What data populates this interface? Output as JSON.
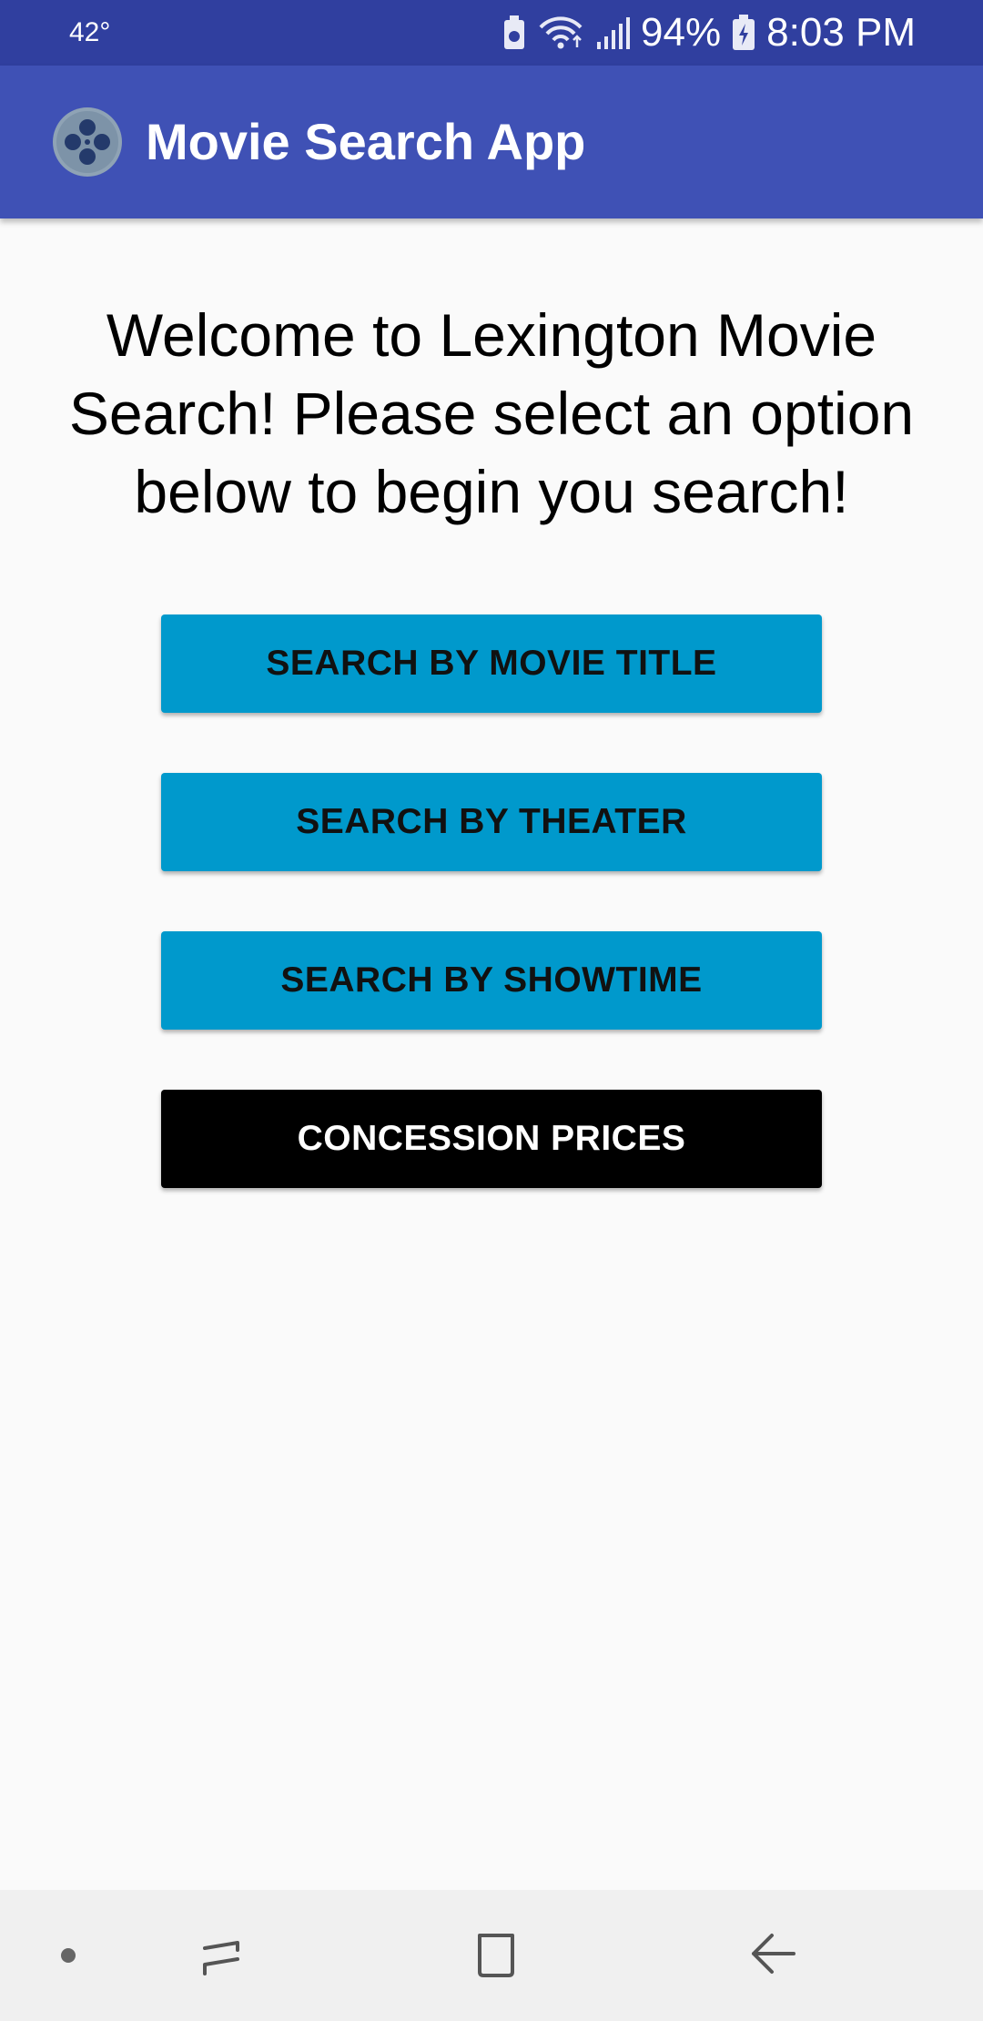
{
  "status_bar": {
    "temperature": "42°",
    "battery_percent": "94%",
    "time": "8:03 PM",
    "icons": [
      "battery-saver-icon",
      "wifi-icon",
      "signal-icon",
      "battery-charging-icon"
    ]
  },
  "app_bar": {
    "title": "Movie Search App",
    "logo_icon": "film-reel-icon"
  },
  "welcome_text": "Welcome to Lexington Movie Search! Please select an option below to begin you search!",
  "buttons": [
    {
      "label": "SEARCH BY MOVIE TITLE",
      "style": "blue"
    },
    {
      "label": "SEARCH BY THEATER",
      "style": "blue"
    },
    {
      "label": "SEARCH BY SHOWTIME",
      "style": "blue"
    },
    {
      "label": "CONCESSION PRICES",
      "style": "black"
    }
  ],
  "nav_bar": {
    "items": [
      "dot-icon",
      "recent-apps-icon",
      "home-icon",
      "back-icon"
    ]
  },
  "colors": {
    "status_bar": "#303f9f",
    "app_bar": "#3f51b5",
    "button_blue": "#0099cc",
    "button_black": "#000000",
    "background": "#fafafa"
  }
}
